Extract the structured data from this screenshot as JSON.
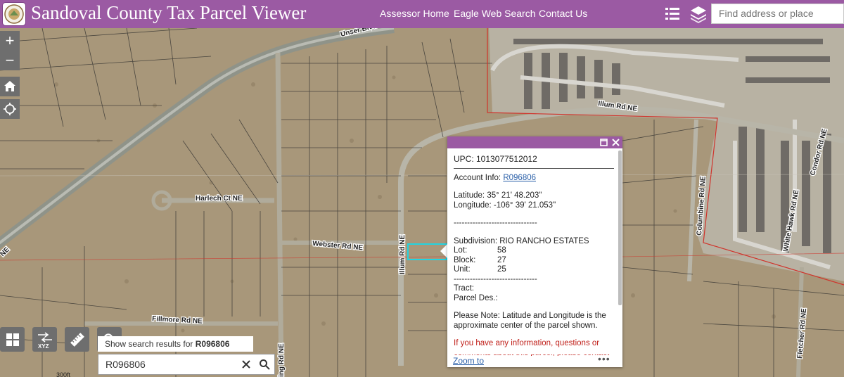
{
  "header": {
    "title": "Sandoval County Tax Parcel Viewer",
    "nav": [
      "Assessor Home",
      "Eagle Web Search",
      "Contact Us"
    ],
    "search_placeholder": "Find address or place",
    "color": "#9b5aa3"
  },
  "map_labels": {
    "unser": "Unser Blvd",
    "illum_ne": "Illum Rd NE",
    "harlech": "Harlech Ct NE",
    "webster": "Webster Rd NE",
    "illum_v": "Illum Rd NE",
    "fillmore": "Fillmore Rd NE",
    "columbine": "Columbine Rd NE",
    "condor": "Condor Rd NE",
    "white_hawk": "White Hawk Rd NE",
    "fletcher": "Fletcher Rd NE",
    "ne_left": "NE",
    "king_rd": "ing Rd NE",
    "scale": "300ft"
  },
  "controls": {
    "zoom_in": "+",
    "zoom_out": "−",
    "xyz": "XYZ"
  },
  "search": {
    "hint_prefix": "Show search results for",
    "hint_value": "R096806",
    "value": "R096806"
  },
  "popup": {
    "upc": "UPC: 1013077512012",
    "account_label": "Account Info:",
    "account_value": "R096806",
    "latitude": "Latitude: 35° 21' 48.203\"",
    "longitude": "Longitude: -106° 39' 21.053\"",
    "divider1": "-------------------------------",
    "subdivision": "Subdivision: RIO RANCHO ESTATES",
    "lot_label": "Lot:",
    "lot_value": "58",
    "block_label": "Block:",
    "block_value": "27",
    "unit_label": "Unit:",
    "unit_value": "25",
    "divider2": "-------------------------------",
    "tract": "Tract:",
    "parcel_des": "Parcel Des.:",
    "note": "Please Note: Latitude and Longitude is the approximate center of the parcel shown.",
    "red_note": "If you have any information, questions or",
    "red_note2": "comments about this parcel, please contact",
    "zoom_to": "Zoom to",
    "more": "•••"
  }
}
